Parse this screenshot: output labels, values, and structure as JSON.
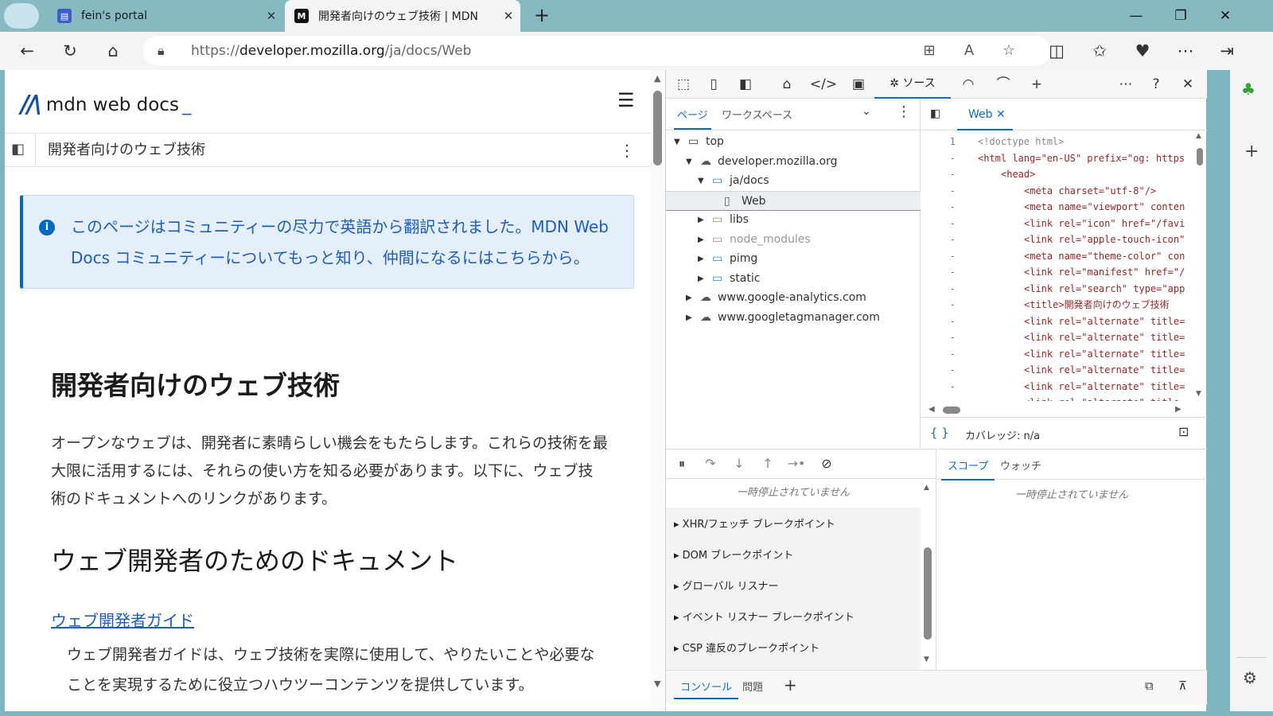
{
  "tabs": [
    {
      "title": "fein's portal",
      "favicon": "portal-icon"
    },
    {
      "title": "開発者向けのウェブ技術 | MDN",
      "favicon": "mdn-icon"
    }
  ],
  "toolbar": {
    "url_prefix": "https://",
    "url_domain": "developer.mozilla.org",
    "url_path": "/ja/docs/Web"
  },
  "page": {
    "logo_text": "mdn web docs",
    "breadcrumb": "開発者向けのウェブ技術",
    "notice": "このページはコミュニティーの尽力で英語から翻訳されました。MDN Web Docs コミュニティーについてもっと知り、仲間になるにはこちらから。",
    "h1": "開発者向けのウェブ技術",
    "p1": "オープンなウェブは、開発者に素晴らしい機会をもたらします。これらの技術を最大限に活用するには、それらの使い方を知る必要があります。以下に、ウェブ技術のドキュメントへのリンクがあります。",
    "h2": "ウェブ開発者のためのドキュメント",
    "link1": "ウェブ開発者ガイド",
    "p2": "ウェブ開発者ガイドは、ウェブ技術を実際に使用して、やりたいことや必要なことを実現するために役立つハウツーコンテンツを提供しています。"
  },
  "devtools": {
    "sources_tab": "ソース",
    "nav_tabs": {
      "page": "ページ",
      "workspace": "ワークスペース"
    },
    "tree": [
      {
        "label": "top",
        "depth": 0,
        "expanded": true,
        "icon": "frame-icon"
      },
      {
        "label": "developer.mozilla.org",
        "depth": 1,
        "expanded": true,
        "icon": "cloud-icon"
      },
      {
        "label": "ja/docs",
        "depth": 2,
        "expanded": true,
        "icon": "folder-icon"
      },
      {
        "label": "Web",
        "depth": 3,
        "selected": true,
        "icon": "file-icon"
      },
      {
        "label": "libs",
        "depth": 2,
        "expanded": false,
        "icon": "folder-icon"
      },
      {
        "label": "node_modules",
        "depth": 2,
        "expanded": false,
        "icon": "folder-icon",
        "dim": true
      },
      {
        "label": "pimg",
        "depth": 2,
        "expanded": false,
        "icon": "folder-icon"
      },
      {
        "label": "static",
        "depth": 2,
        "expanded": false,
        "icon": "folder-icon"
      },
      {
        "label": "www.google-analytics.com",
        "depth": 1,
        "expanded": false,
        "icon": "cloud-icon"
      },
      {
        "label": "www.googletagmanager.com",
        "depth": 1,
        "expanded": false,
        "icon": "cloud-icon"
      }
    ],
    "editor_tab": "Web",
    "code_lines": [
      {
        "num": "1",
        "text": "<!doctype html>",
        "indent": 0
      },
      {
        "num": "-",
        "text": "<html lang=\"en-US\" prefix=\"og: https",
        "indent": 0
      },
      {
        "num": "-",
        "text": "<head>",
        "indent": 1
      },
      {
        "num": "-",
        "text": "<meta charset=\"utf-8\"/>",
        "indent": 2
      },
      {
        "num": "-",
        "text": "<meta name=\"viewport\" conten",
        "indent": 2
      },
      {
        "num": "-",
        "text": "<link rel=\"icon\" href=\"/favi",
        "indent": 2
      },
      {
        "num": "-",
        "text": "<link rel=\"apple-touch-icon\"",
        "indent": 2
      },
      {
        "num": "-",
        "text": "<meta name=\"theme-color\" con",
        "indent": 2
      },
      {
        "num": "-",
        "text": "<link rel=\"manifest\" href=\"/",
        "indent": 2
      },
      {
        "num": "-",
        "text": "<link rel=\"search\" type=\"app",
        "indent": 2
      },
      {
        "num": "-",
        "text": "<title>開発者向けのウェブ技術",
        "indent": 2
      },
      {
        "num": "-",
        "text": "<link rel=\"alternate\" title=",
        "indent": 2
      },
      {
        "num": "-",
        "text": "<link rel=\"alternate\" title=",
        "indent": 2
      },
      {
        "num": "-",
        "text": "<link rel=\"alternate\" title=",
        "indent": 2
      },
      {
        "num": "-",
        "text": "<link rel=\"alternate\" title=",
        "indent": 2
      },
      {
        "num": "-",
        "text": "<link rel=\"alternate\" title=",
        "indent": 2
      },
      {
        "num": "-",
        "text": "<link rel=\"alternate\" title=",
        "indent": 2
      }
    ],
    "coverage": "カバレッジ: n/a",
    "not_paused": "一時停止されていません",
    "breakpoints": [
      "XHR/フェッチ ブレークポイント",
      "DOM ブレークポイント",
      "グローバル リスナー",
      "イベント リスナー ブレークポイント",
      "CSP 違反のブレークポイント"
    ],
    "scope_tab": "スコープ",
    "watch_tab": "ウォッチ",
    "drawer": {
      "console": "コンソール",
      "issues": "問題"
    }
  },
  "colors": {
    "accent": "#0f6cbd",
    "mdn_blue": "#1b5ebe",
    "tabstrip": "#86b9c2"
  }
}
